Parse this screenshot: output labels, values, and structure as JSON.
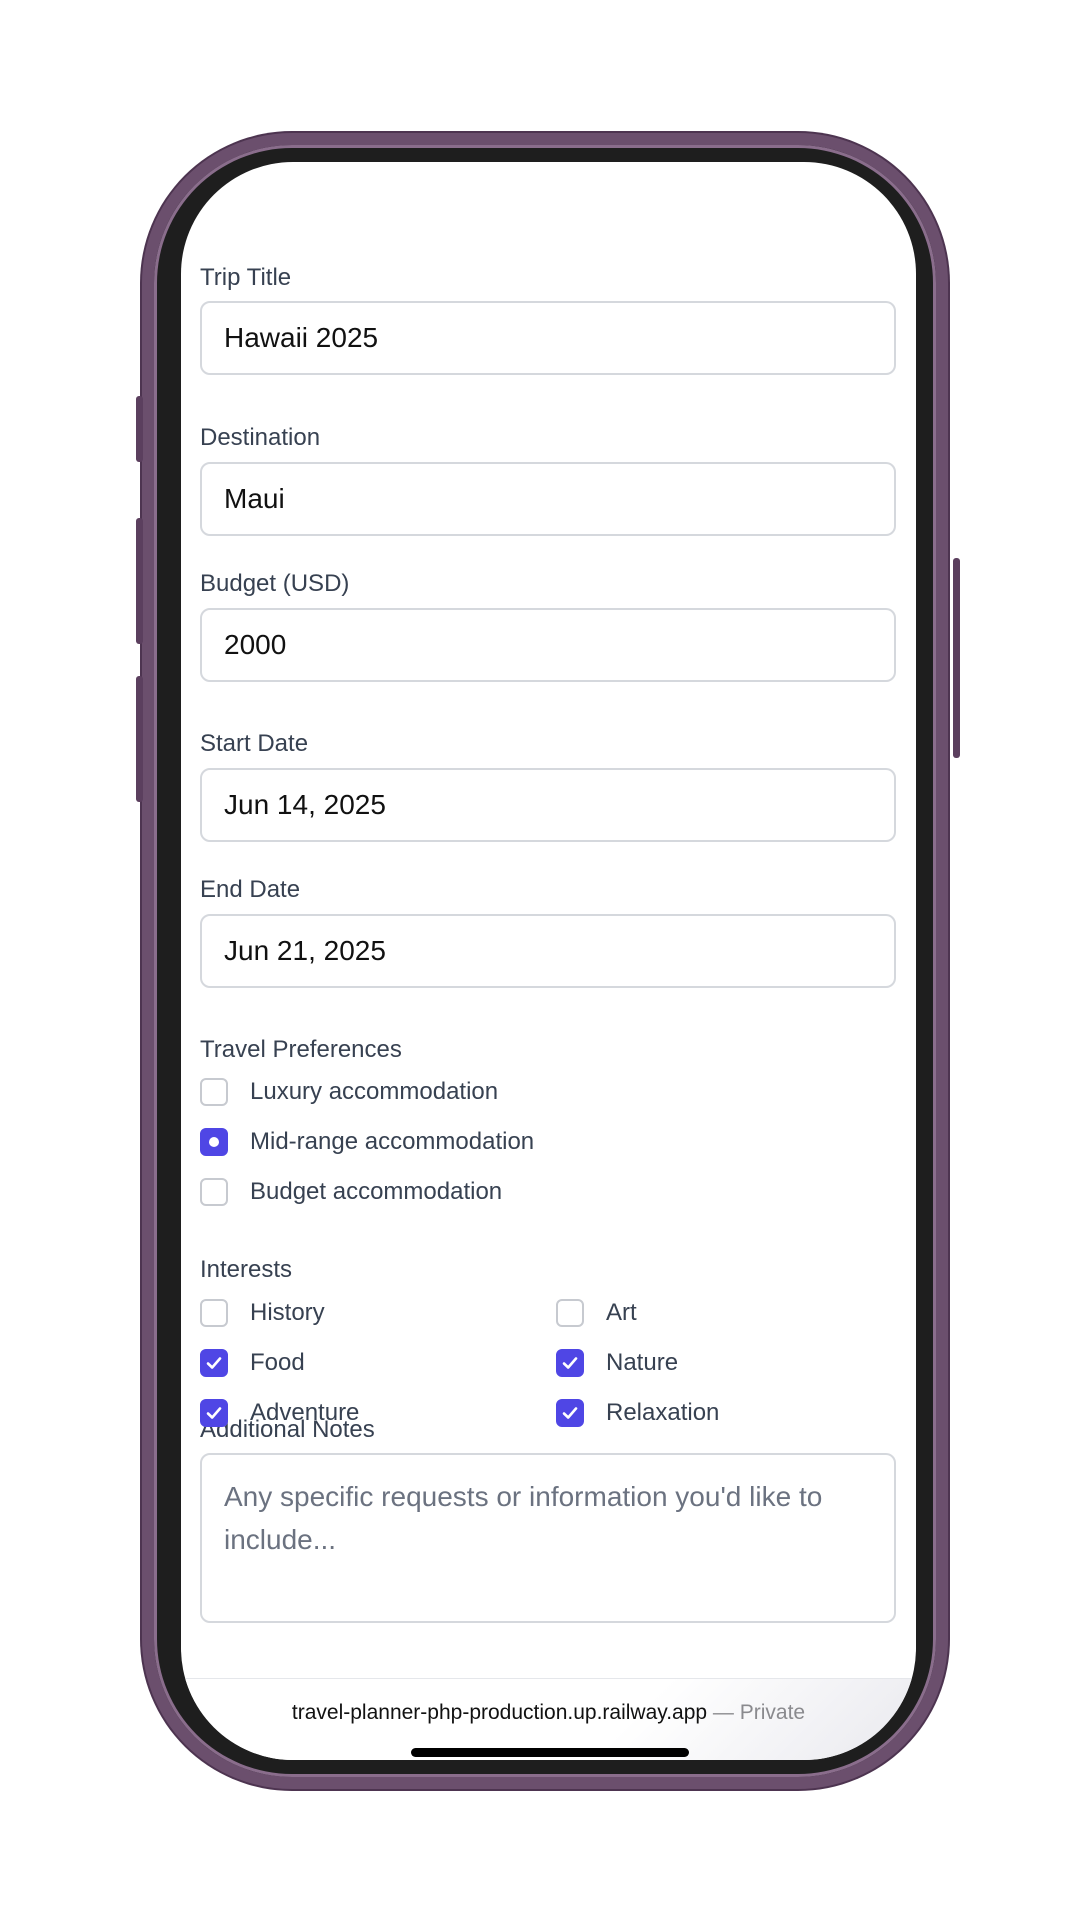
{
  "form": {
    "trip_title": {
      "label": "Trip Title",
      "value": "Hawaii 2025"
    },
    "destination": {
      "label": "Destination",
      "value": "Maui"
    },
    "budget": {
      "label": "Budget (USD)",
      "value": "2000"
    },
    "start_date": {
      "label": "Start Date",
      "value": "Jun 14, 2025"
    },
    "end_date": {
      "label": "End Date",
      "value": "Jun 21, 2025"
    },
    "preferences": {
      "label": "Travel Preferences",
      "options": [
        {
          "label": "Luxury accommodation",
          "selected": false
        },
        {
          "label": "Mid-range accommodation",
          "selected": true
        },
        {
          "label": "Budget accommodation",
          "selected": false
        }
      ]
    },
    "interests": {
      "label": "Interests",
      "options": [
        {
          "label": "History",
          "checked": false
        },
        {
          "label": "Art",
          "checked": false
        },
        {
          "label": "Food",
          "checked": true
        },
        {
          "label": "Nature",
          "checked": true
        },
        {
          "label": "Adventure",
          "checked": true
        },
        {
          "label": "Relaxation",
          "checked": true
        }
      ]
    },
    "notes": {
      "label": "Additional Notes",
      "placeholder": "Any specific requests or information you'd like to include..."
    }
  },
  "browser": {
    "url": "travel-planner-php-production.up.railway.app",
    "separator": " — ",
    "privacy": "Private"
  },
  "colors": {
    "accent": "#4f46e5",
    "frame": "#6b4f6d"
  }
}
